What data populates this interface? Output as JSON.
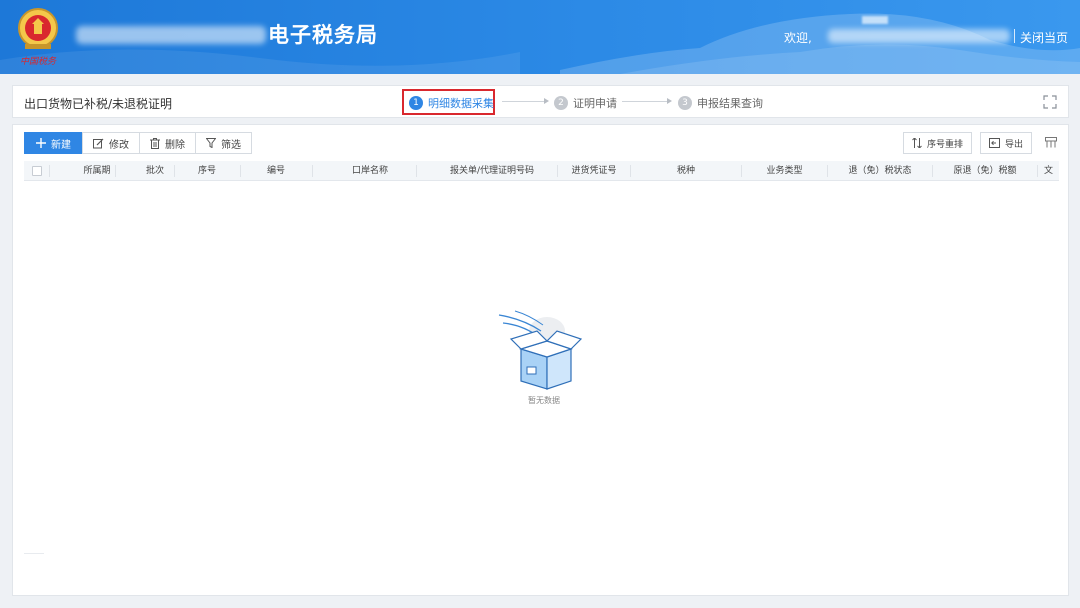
{
  "header": {
    "bureau_title": "电子税务局",
    "welcome": "欢迎,",
    "close_page": "关闭当页",
    "emblem_text": "中国税务"
  },
  "stepbar": {
    "page_title": "出口货物已补税/未退税证明",
    "steps": [
      {
        "num": "1",
        "label": "明细数据采集"
      },
      {
        "num": "2",
        "label": "证明申请"
      },
      {
        "num": "3",
        "label": "申报结果查询"
      }
    ]
  },
  "toolbar": {
    "new": "新建",
    "edit": "修改",
    "delete": "删除",
    "filter": "筛选",
    "sort_reset": "序号重排",
    "export": "导出"
  },
  "table": {
    "columns": [
      "所属期",
      "批次",
      "序号",
      "编号",
      "口岸名称",
      "报关单/代理证明号码",
      "进货凭证号",
      "税种",
      "业务类型",
      "退（免）税状态",
      "原退（免）税额",
      "文"
    ],
    "empty_text": "暂无数据"
  },
  "colors": {
    "brand_blue": "#2f86e4",
    "header_blue": "#1d78d8",
    "highlight_red": "#d9282e"
  }
}
